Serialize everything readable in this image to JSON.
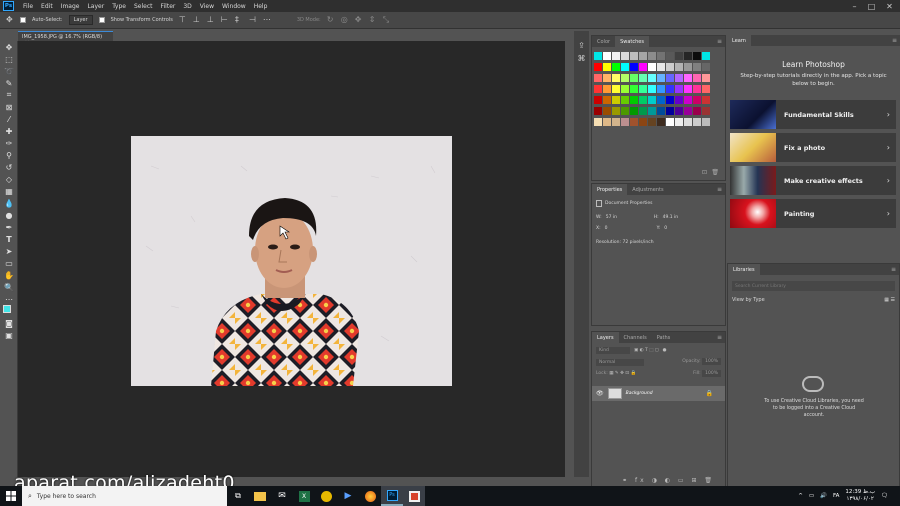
{
  "app": {
    "logo": "Ps"
  },
  "menubar": {
    "items": [
      "File",
      "Edit",
      "Image",
      "Layer",
      "Type",
      "Select",
      "Filter",
      "3D",
      "View",
      "Window",
      "Help"
    ]
  },
  "options_bar": {
    "auto_select_label": "Auto-Select:",
    "auto_select_value": "Layer",
    "show_transform_label": "Show Transform Controls",
    "mode_3d_label": "3D Mode:"
  },
  "document": {
    "tab_title": "IMG_1958.JPG @ 16.7% (RGB/8)"
  },
  "color_panel": {
    "tabs": [
      "Color",
      "Swatches"
    ],
    "active": "Swatches"
  },
  "properties_panel": {
    "tabs": [
      "Properties",
      "Adjustments"
    ],
    "section_title": "Document Properties",
    "w_label": "W:",
    "w_value": "57 in",
    "h_label": "H:",
    "h_value": "49.1 in",
    "x_label": "X:",
    "x_value": "0",
    "y_label": "Y:",
    "y_value": "0",
    "resolution": "Resolution: 72 pixels/inch"
  },
  "layers_panel": {
    "tabs": [
      "Layers",
      "Channels",
      "Paths"
    ],
    "kind_placeholder": "Kind",
    "blend_mode": "Normal",
    "opacity_label": "Opacity:",
    "opacity_value": "100%",
    "lock_label": "Lock:",
    "fill_label": "Fill:",
    "fill_value": "100%",
    "layer_name": "Background"
  },
  "learn_panel": {
    "tab": "Learn",
    "title": "Learn Photoshop",
    "subtitle": "Step-by-step tutorials directly in the app. Pick a topic below to begin.",
    "cards": [
      {
        "label": "Fundamental Skills"
      },
      {
        "label": "Fix a photo"
      },
      {
        "label": "Make creative effects"
      },
      {
        "label": "Painting"
      }
    ]
  },
  "libraries_panel": {
    "tab": "Libraries",
    "search_placeholder": "Search Current Library",
    "view_by": "View by Type",
    "message": "To use Creative Cloud Libraries, you need to be logged into a Creative Cloud account."
  },
  "watermark": "aparat.com/alizadeht0",
  "taskbar": {
    "search_placeholder": "Type here to search",
    "lang": "FA",
    "time": "12:39 ب.ظ",
    "date": "۱۳۹۸/۰۶/۰۲"
  },
  "colors": {
    "accent": "#31a8ff",
    "app_bg": "#535353",
    "canvas_bg": "#282828",
    "panel_tab_bg": "#424242"
  }
}
